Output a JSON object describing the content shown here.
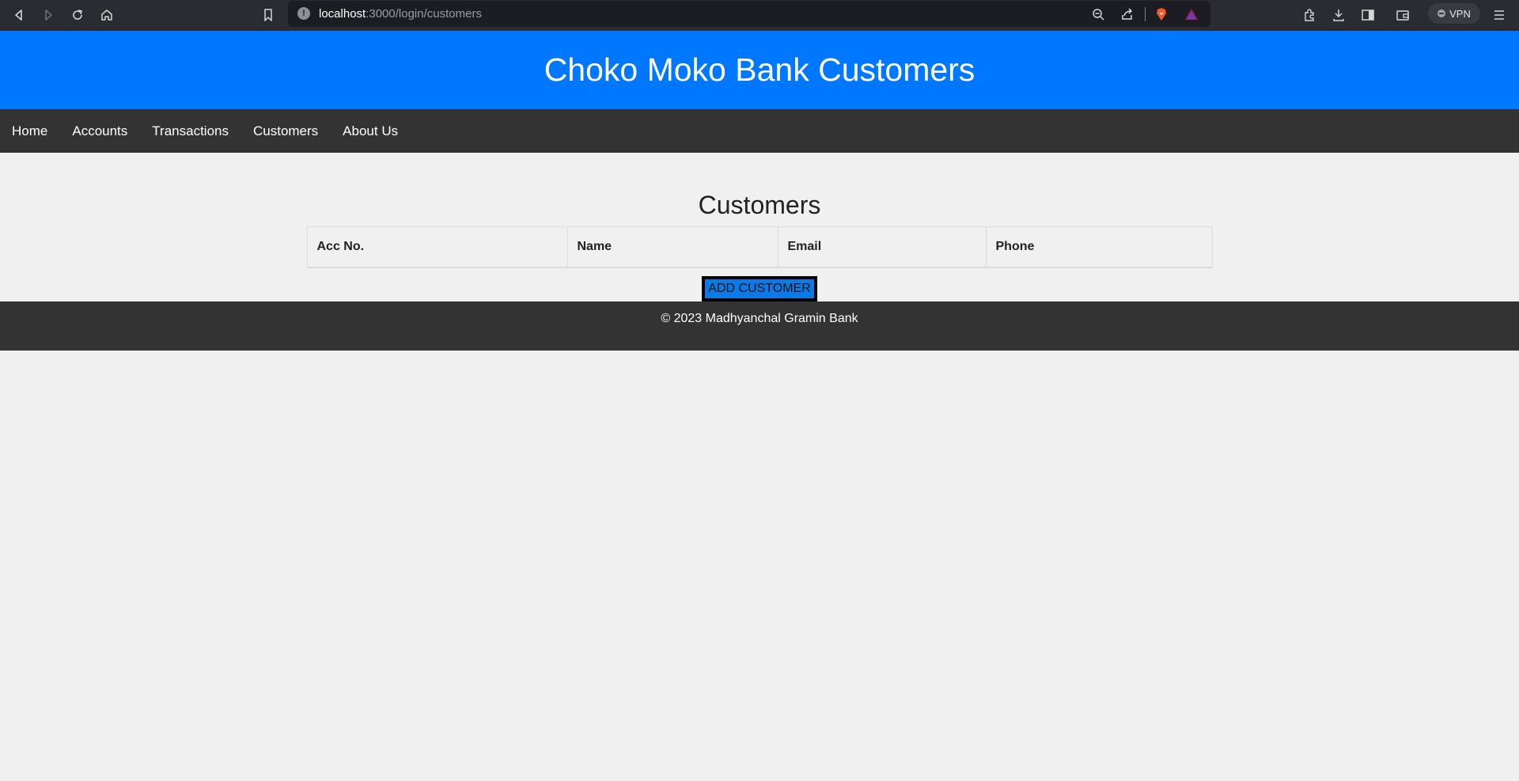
{
  "browser": {
    "url_host": "localhost",
    "url_path": ":3000/login/customers",
    "vpn_label": "VPN",
    "info_glyph": "!"
  },
  "header": {
    "title": "Choko Moko Bank Customers"
  },
  "nav": {
    "items": [
      "Home",
      "Accounts",
      "Transactions",
      "Customers",
      "About Us"
    ]
  },
  "main": {
    "heading": "Customers",
    "table": {
      "columns": [
        "Acc No.",
        "Name",
        "Email",
        "Phone"
      ],
      "rows": []
    },
    "add_button": "ADD CUSTOMER"
  },
  "footer": {
    "text": "© 2023 Madhyanchal Gramin Bank"
  },
  "colors": {
    "header_bg": "#0077ff",
    "nav_bg": "#333333",
    "button_bg": "#0a7ae8",
    "page_bg": "#f0f0f0"
  }
}
